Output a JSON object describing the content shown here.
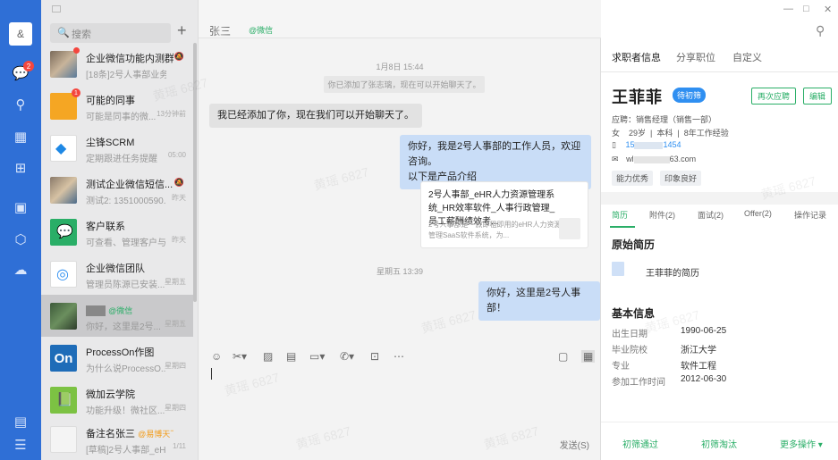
{
  "rail": {
    "profile_label": "&",
    "chat_badge": "2"
  },
  "list": {
    "search_placeholder": "搜索",
    "conversations": [
      {
        "name": "企业微信功能内测群",
        "preview": "[18条]2号人事部业务...",
        "time": "",
        "badge": "dot"
      },
      {
        "name": "可能的同事",
        "preview": "可能是同事的微...",
        "time": "13分钟前",
        "badge": "1"
      },
      {
        "name": "尘锋SCRM",
        "preview": "定期跟进任务提醒",
        "time": "05:00",
        "badge": ""
      },
      {
        "name": "测试企业微信短信...",
        "preview": "测试2: 1351000590...",
        "time": "昨天",
        "badge": ""
      },
      {
        "name": "客户联系",
        "preview": "可查看、管理客户与...",
        "time": "昨天",
        "badge": ""
      },
      {
        "name": "企业微信团队",
        "preview": "管理员陈源已安装...",
        "time": "星期五",
        "badge": ""
      },
      {
        "name": "张三",
        "tag": "@微信",
        "preview": "你好，这里是2号...",
        "time": "星期五",
        "badge": ""
      },
      {
        "name": "ProcessOn作图",
        "preview": "为什么说ProcessO...",
        "time": "星期四",
        "badge": ""
      },
      {
        "name": "微加云学院",
        "preview": "功能升级！微社区...",
        "time": "星期四",
        "badge": ""
      },
      {
        "name": "备注名张三",
        "tag2": "@易博天下",
        "preview": "[草稿]2号人事部_eH...",
        "time": "1/11",
        "badge": ""
      }
    ]
  },
  "chat": {
    "title": "张三",
    "title_tag": "@微信",
    "ts1": "1月8日 15:44",
    "sys1": "你已添加了张志璃，现在可以开始聊天了。",
    "msg_left": "我已经添加了你，现在我们可以开始聊天了。",
    "msg_right1_l1": "你好，我是2号人事部的工作人员，欢迎咨询。",
    "msg_right1_l2": "以下是产品介绍",
    "card_title": "2号人事部_eHR人力资源管理系统_HR效率软件_人事行政管理_员工薪酬绩效考...",
    "card_desc": "2号人事部是一款即租即用的eHR人力资源管理SaaS软件系统，为...",
    "ts2": "星期五 13:39",
    "msg_right2": "你好，这里是2号人事部！",
    "send": "发送(S)"
  },
  "panel": {
    "tabs": [
      "求职者信息",
      "分享职位",
      "自定义"
    ],
    "name": "王菲菲",
    "stage": "待初筛",
    "btn_reapply": "再次应聘",
    "btn_edit": "编辑",
    "apply": "应聘：销售经理（销售一部）",
    "meta": "女    29岁  |  本科  |  8年工作经验",
    "phone_a": "15",
    "phone_b": "1454",
    "email_a": "wl",
    "email_b": "63.com",
    "chips": [
      "能力优秀",
      "印象良好"
    ],
    "subtabs": [
      "简历",
      "附件(2)",
      "面试(2)",
      "Offer(2)",
      "操作记录"
    ],
    "sec_resume": "原始简历",
    "resume_name": "王菲菲的简历",
    "sec_basic": "基本信息",
    "basic": [
      {
        "k": "出生日期",
        "v": "1990-06-25"
      },
      {
        "k": "毕业院校",
        "v": "浙江大学"
      },
      {
        "k": "专业",
        "v": "软件工程"
      },
      {
        "k": "参加工作时间",
        "v": "2012-06-30"
      }
    ],
    "footer": [
      "初筛通过",
      "初筛淘汰",
      "更多操作 ▾"
    ]
  },
  "watermark": "黄瑶 6827"
}
